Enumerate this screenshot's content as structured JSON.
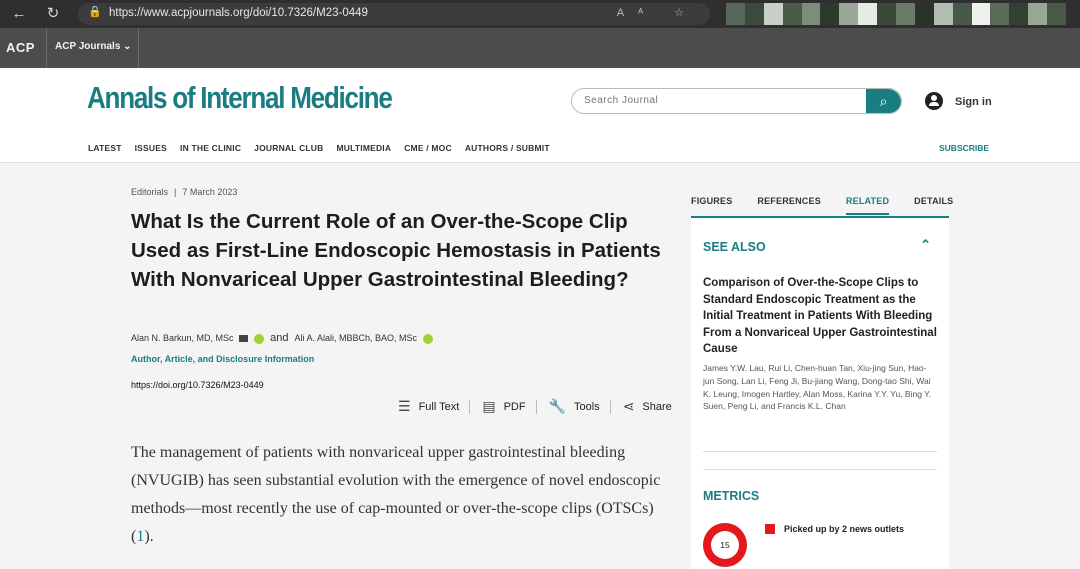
{
  "browser": {
    "url": "https://www.acpjournals.org/doi/10.7326/M23-0449",
    "back_icon": "arrow-left-icon",
    "refresh_icon": "refresh-icon"
  },
  "acp_bar": {
    "logo": "ACP",
    "menu_label": "ACP Journals"
  },
  "header": {
    "journal_name": "Annals of Internal Medicine",
    "search_placeholder": "Search Journal",
    "signin_label": "Sign in",
    "subnav": [
      "LATEST",
      "ISSUES",
      "IN THE CLINIC",
      "JOURNAL CLUB",
      "MULTIMEDIA",
      "CME / MOC",
      "AUTHORS / SUBMIT"
    ],
    "subscribe_label": "SUBSCRIBE"
  },
  "article": {
    "type": "Editorials",
    "date": "7 March 2023",
    "title": "What Is the Current Role of an Over-the-Scope Clip Used as First-Line Endoscopic Hemostasis in Patients With Nonvariceal Upper Gastrointestinal Bleeding?",
    "author1": "Alan N. Barkun, MD, MSc",
    "and": "and",
    "author2": "Ali A. Alali, MBBCh, BAO, MSc",
    "disclosure": "Author, Article, and Disclosure Information",
    "doi": "https://doi.org/10.7326/M23-0449",
    "tools": {
      "full_text": "Full Text",
      "pdf": "PDF",
      "tools": "Tools",
      "share": "Share"
    },
    "body_text": "The management of patients with nonvariceal upper gastrointestinal bleeding (NVUGIB) has seen substantial evolution with the emergence of novel endoscopic methods—most recently the use of cap-mounted or over-the-scope clips (OTSCs) (",
    "body_ref": "1",
    "body_end": ")."
  },
  "sidebar": {
    "tabs": [
      "FIGURES",
      "REFERENCES",
      "RELATED",
      "DETAILS"
    ],
    "active_tab": "RELATED",
    "see_also": "SEE ALSO",
    "related_title": "Comparison of Over-the-Scope Clips to Standard Endoscopic Treatment as the Initial Treatment in Patients With Bleeding From a Nonvariceal Upper Gastrointestinal Cause",
    "related_authors": "James Y.W. Lau, Rui Li, Chen-huan Tan, Xiu-jing Sun, Hao-jun Song, Lan Li, Feng Ji, Bu-jiang Wang, Dong-tao Shi, Wai K. Leung, Imogen Hartley, Alan Moss, Karina Y.Y. Yu, Bing Y. Suen, Peng Li, and Francis K.L. Chan",
    "metrics": "METRICS",
    "altmetric_score": "15",
    "news_label": "Picked up by 2 news outlets"
  },
  "colors": {
    "brand": "#1a7d82",
    "altmetric_red": "#e4181d"
  }
}
